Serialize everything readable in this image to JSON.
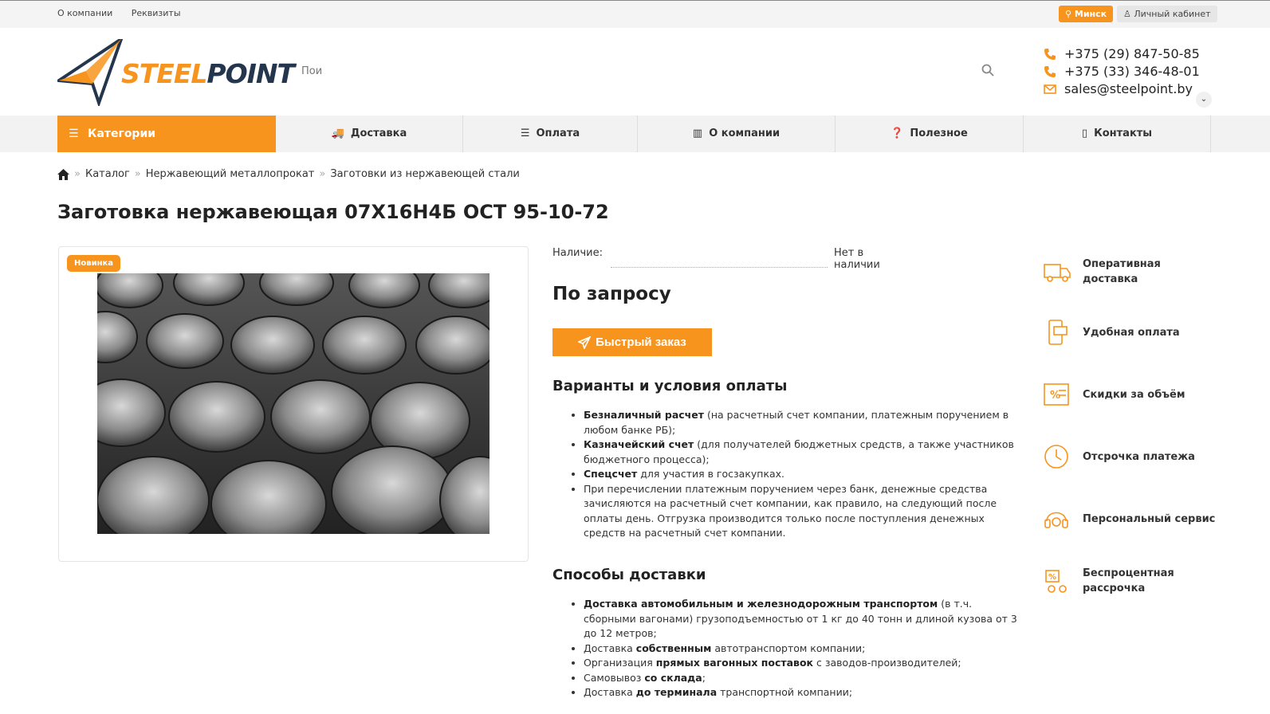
{
  "topbar": {
    "links": [
      "О компании",
      "Реквизиты"
    ],
    "city": "Минск",
    "cabinet": "Личный кабинет"
  },
  "header": {
    "logo_part1": "STEEL",
    "logo_part2": "POINT",
    "search_placeholder": "Пои",
    "phone1": "+375 (29) 847-50-85",
    "phone2": "+375 (33) 346-48-01",
    "email": "sales@steelpoint.by"
  },
  "nav": {
    "categories": "Категории",
    "items": [
      "Доставка",
      "Оплата",
      "О компании",
      "Полезное",
      "Контакты"
    ]
  },
  "breadcrumbs": [
    "Каталог",
    "Нержавеющий металлопрокат",
    "Заготовки из нержавеющей стали"
  ],
  "product": {
    "title": "Заготовка нержавеющая 07Х16Н4Б ОСТ 95-10-72",
    "badge": "Новинка",
    "availability_label": "Наличие:",
    "availability_value": "Нет в наличии",
    "price": "По запросу",
    "order_button": "Быстрый заказ"
  },
  "payment": {
    "heading": "Варианты и условия оплаты",
    "items": [
      {
        "bold": "Безналичный расчет",
        "text": " (на расчетный счет компании, платежным поручением в любом банке РБ);"
      },
      {
        "bold": "Казначейский счет",
        "text": " (для получателей бюджетных средств, а также участников бюджетного процесса);"
      },
      {
        "bold": "Спецсчет",
        "text": " для участия в госзакупках."
      },
      {
        "bold": "",
        "text": "При перечислении платежным поручением через банк, денежные средства зачисляются на расчетный счет компании, как правило, на следующий после оплаты день. Отгрузка производится только после поступления денежных средств на расчетный счет компании."
      }
    ]
  },
  "delivery": {
    "heading": "Способы доставки",
    "items": [
      {
        "pre": "",
        "bold": "Доставка автомобильным и железнодорожным транспортом",
        "text": " (в т.ч. сборными вагонами) грузоподъемностью от 1 кг до 40 тонн и длиной кузова от 3 до 12 метров;"
      },
      {
        "pre": "Доставка ",
        "bold": "собственным",
        "text": " автотранспортом компании;"
      },
      {
        "pre": "Организация ",
        "bold": "прямых вагонных поставок",
        "text": " с заводов-производителей;"
      },
      {
        "pre": "Самовывоз ",
        "bold": "со склада",
        "text": ";"
      },
      {
        "pre": "Доставка ",
        "bold": "до терминала",
        "text": " транспортной компании;"
      }
    ]
  },
  "advantages": [
    "Оперативная доставка",
    "Удобная оплата",
    "Скидки за объём",
    "Отсрочка платежа",
    "Персональный сервис",
    "Беспроцентная рассрочка"
  ],
  "colors": {
    "accent": "#f7941d",
    "dark": "#23364d"
  }
}
